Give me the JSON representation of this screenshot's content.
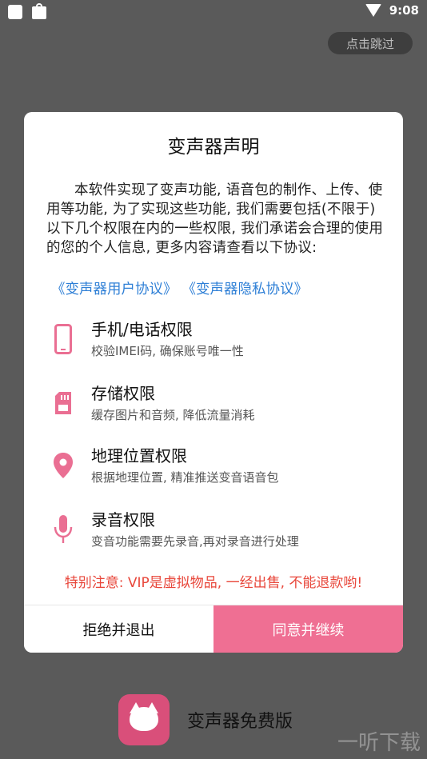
{
  "status_bar": {
    "time": "9:08"
  },
  "skip_button": {
    "label": "点击跳过"
  },
  "dialog": {
    "title": "变声器声明",
    "body": "本软件实现了变声功能, 语音包的制作、上传、使用等功能, 为了实现这些功能, 我们需要包括(不限于)以下几个权限在内的一些权限, 我们承诺会合理的使用的您的个人信息, 更多内容请查看以下协议:",
    "links": [
      "《变声器用户协议》",
      "《变声器隐私协议》"
    ],
    "permissions": [
      {
        "icon": "phone-icon",
        "title": "手机/电话权限",
        "desc": "校验IMEI码, 确保账号唯一性"
      },
      {
        "icon": "sd-card-icon",
        "title": "存储权限",
        "desc": "缓存图片和音频, 降低流量消耗"
      },
      {
        "icon": "location-pin-icon",
        "title": "地理位置权限",
        "desc": "根据地理位置, 精准推送变音语音包"
      },
      {
        "icon": "microphone-icon",
        "title": "录音权限",
        "desc": "变音功能需要先录音,再对录音进行处理"
      }
    ],
    "notice": "特别注意: VIP是虚拟物品, 一经出售, 不能退款哟!",
    "reject_label": "拒绝并退出",
    "agree_label": "同意并继续"
  },
  "app": {
    "name": "变声器免费版"
  },
  "watermark": {
    "text": "一听下载"
  },
  "colors": {
    "accent": "#ef6f93",
    "link": "#2e7fd6",
    "warning": "#e8463a",
    "icon": "#ea6f93"
  }
}
